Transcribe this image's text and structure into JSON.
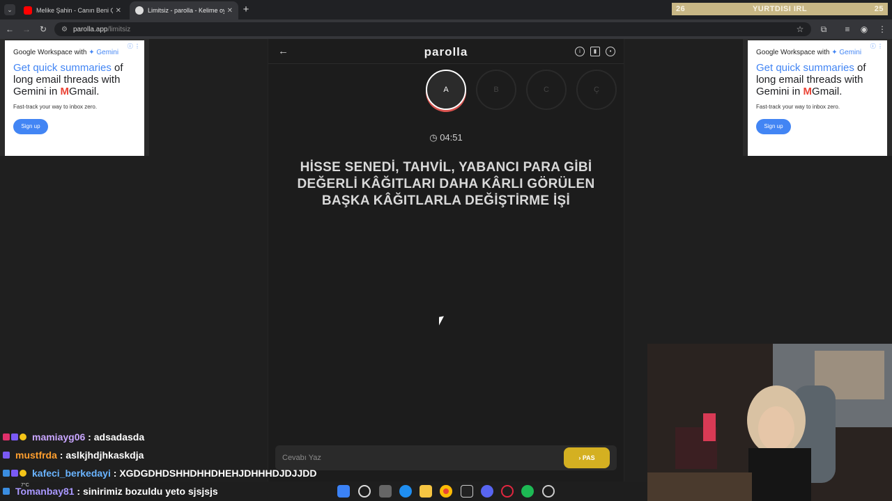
{
  "browser": {
    "tabs": [
      {
        "title": "Melike Şahin - Canın Beni Çekti",
        "favicon_color": "#ff0000"
      },
      {
        "title": "Limitsiz - parolla - Kelime oyunu",
        "favicon_color": "#dddddd"
      }
    ],
    "url_host": "parolla.app",
    "url_path": "/limitsiz"
  },
  "overlay": {
    "left": "26",
    "title": "YURTDISI IRL",
    "right": "25"
  },
  "ad": {
    "brand_prefix": "Google Workspace with ",
    "brand_product": "✦ Gemini",
    "headline_highlight": "Get quick summaries",
    "headline_rest": " of long email threads with Gemini in ",
    "headline_gmail": "M",
    "headline_end": "Gmail.",
    "subtext": "Fast-track your way to inbox zero.",
    "cta": "Sign up"
  },
  "game": {
    "logo": "parolla",
    "letters": [
      "A",
      "B",
      "C",
      "Ç"
    ],
    "active_letter": "A",
    "timer": "04:51",
    "question": "HİSSE SENEDİ, TAHVİL, YABANCI PARA GİBİ DEĞERLİ KÂĞITLARI DAHA KÂRLI GÖRÜLEN BAŞKA KÂĞITLARLA DEĞİŞTİRME İŞİ",
    "answer_placeholder": "Cevabı Yaz",
    "pass_label": "PAS"
  },
  "chat": [
    {
      "name": "mamiayg06",
      "name_color": "#c9a6ff",
      "message": "adsadasda"
    },
    {
      "name": "mustfrda",
      "name_color": "#ff9f2e",
      "message": "aslkjhdjhkaskdja"
    },
    {
      "name": "kafeci_berkedayi",
      "name_color": "#6ab4ff",
      "message": "XGDGDHDSHHDHHDHEHJDHHHDJDJJDD"
    },
    {
      "name": "Tomanbay81",
      "name_color": "#a998ff",
      "message": "sinirimiz bozuldu yeto sjsjsjs"
    }
  ],
  "weather": "7°C",
  "colors": {
    "accent_yellow": "#d4b021",
    "active_ring_red": "#d9534f",
    "ad_blue": "#4285f4"
  }
}
